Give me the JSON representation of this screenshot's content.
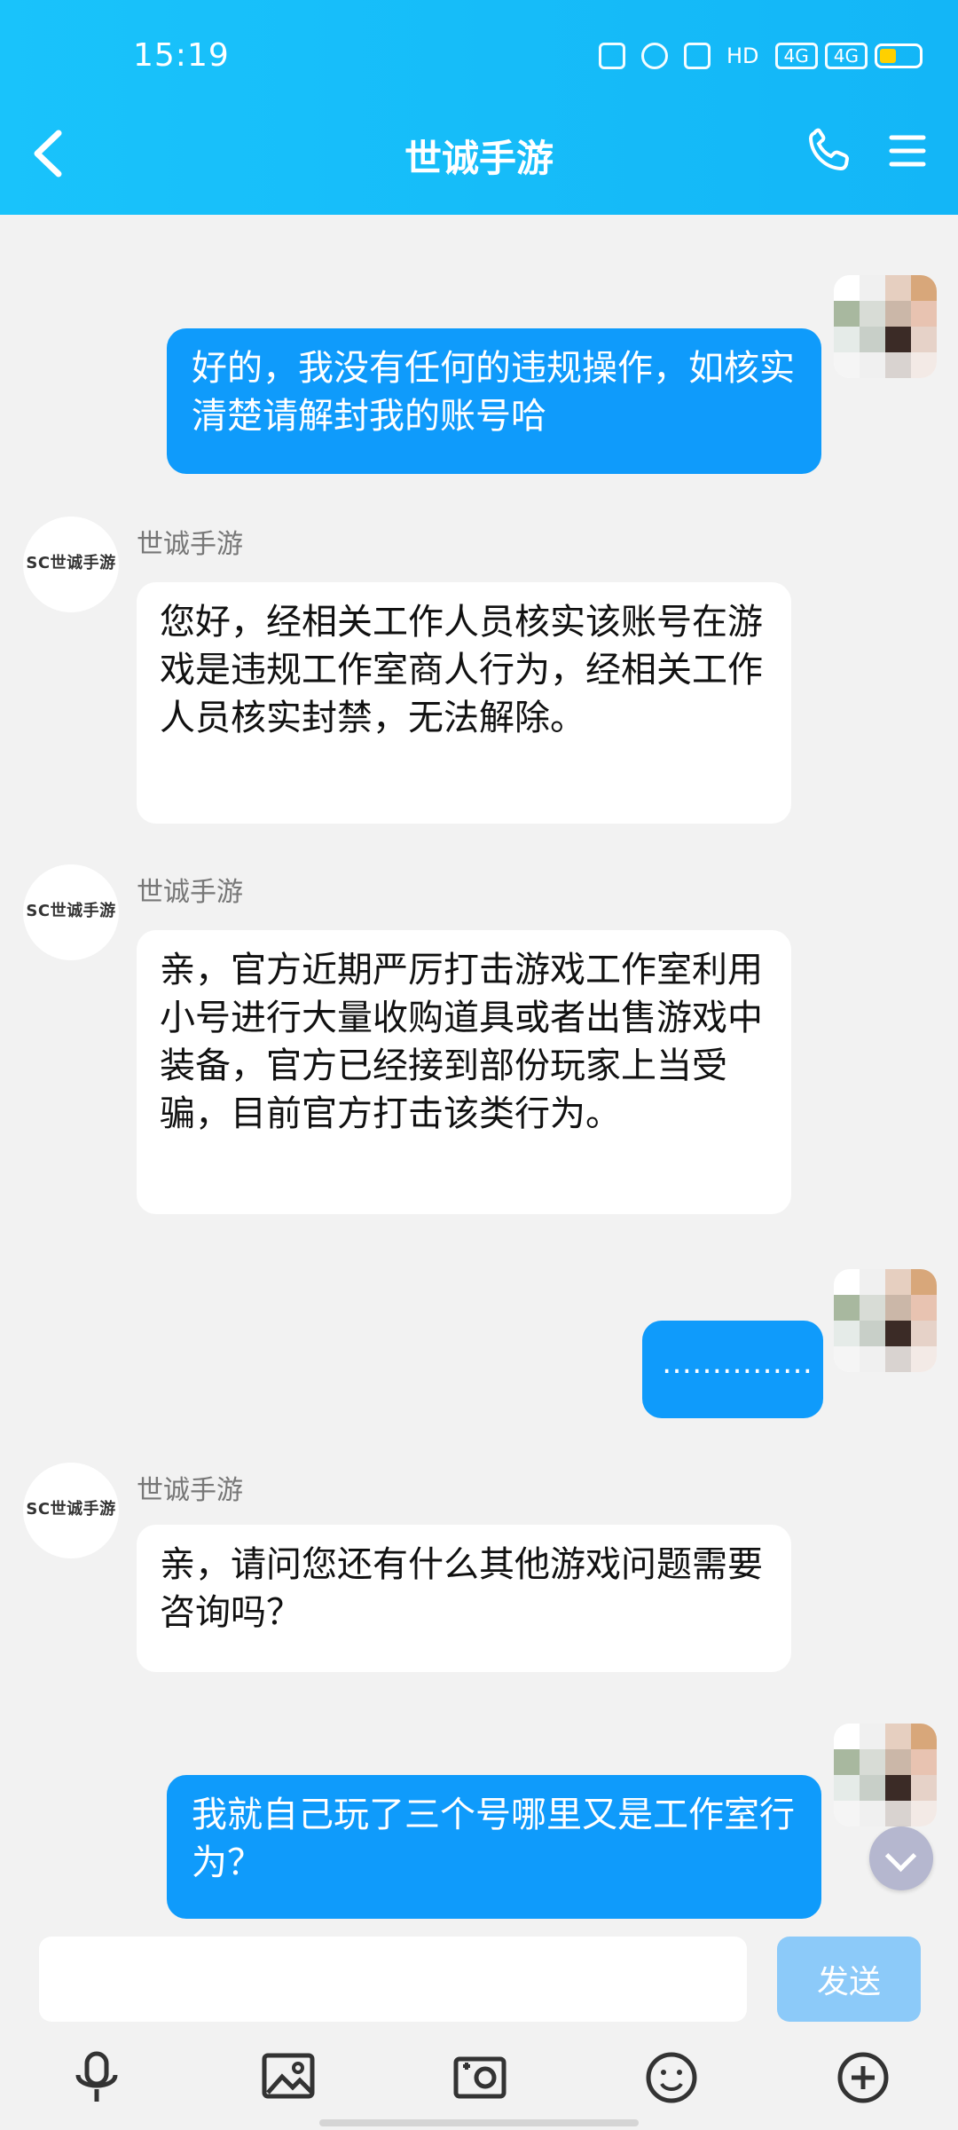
{
  "status": {
    "time": "15:19",
    "hd": "HD",
    "net1": "4G",
    "net2": "4G"
  },
  "header": {
    "title": "世诚手游"
  },
  "agent": {
    "name": "世诚手游",
    "logo_text": "SC世诚手游"
  },
  "messages": [
    {
      "side": "right",
      "text": "好的，我没有任何的违规操作，如核实清楚请解封我的账号哈"
    },
    {
      "side": "left",
      "text": "您好，经相关工作人员核实该账号在游戏是违规工作室商人行为，经相关工作人员核实封禁，无法解除。"
    },
    {
      "side": "left",
      "text": "亲，官方近期严厉打击游戏工作室利用小号进行大量收购道具或者出售游戏中装备，官方已经接到部份玩家上当受骗，目前官方打击该类行为。"
    },
    {
      "side": "right",
      "text": "……………"
    },
    {
      "side": "left",
      "text": "亲，请问您还有什么其他游戏问题需要咨询吗？"
    },
    {
      "side": "right",
      "text": "我就自己玩了三个号哪里又是工作室行为？"
    }
  ],
  "composer": {
    "placeholder": "",
    "send_label": "发送"
  },
  "toolbar": {
    "icons": [
      "microphone-icon",
      "image-icon",
      "camera-icon",
      "emoji-icon",
      "plus-icon"
    ]
  },
  "colors": {
    "header_bg": "#19c3fb",
    "blue_bubble": "#0f9bfb",
    "send_button": "#8ccaf9"
  }
}
